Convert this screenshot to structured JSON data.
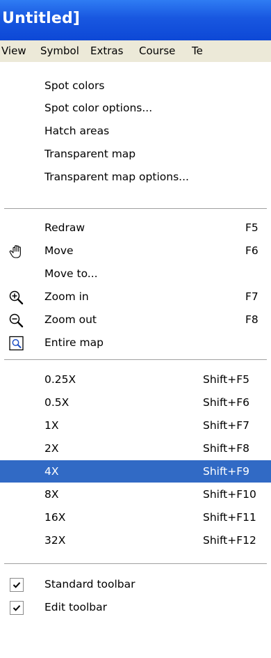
{
  "window": {
    "title": "Untitled]"
  },
  "menubar": {
    "items": [
      "View",
      "Symbol",
      "Extras",
      "Course",
      "Te"
    ]
  },
  "menu": {
    "group1": [
      {
        "label": "Spot colors"
      },
      {
        "label": "Spot color options..."
      },
      {
        "label": "Hatch areas"
      },
      {
        "label": "Transparent map"
      },
      {
        "label": "Transparent map options..."
      }
    ],
    "group2": [
      {
        "label": "Redraw",
        "shortcut": "F5",
        "icon": ""
      },
      {
        "label": "Move",
        "shortcut": "F6",
        "icon": "hand-icon"
      },
      {
        "label": "Move to...",
        "shortcut": "",
        "icon": ""
      },
      {
        "label": "Zoom in",
        "shortcut": "F7",
        "icon": "zoom-in-icon"
      },
      {
        "label": "Zoom out",
        "shortcut": "F8",
        "icon": "zoom-out-icon"
      },
      {
        "label": "Entire map",
        "shortcut": "",
        "icon": "entire-map-icon"
      }
    ],
    "group3": [
      {
        "label": "0.25X",
        "shortcut": "Shift+F5"
      },
      {
        "label": "0.5X",
        "shortcut": "Shift+F6"
      },
      {
        "label": "1X",
        "shortcut": "Shift+F7"
      },
      {
        "label": "2X",
        "shortcut": "Shift+F8"
      },
      {
        "label": "4X",
        "shortcut": "Shift+F9",
        "selected": true
      },
      {
        "label": "8X",
        "shortcut": "Shift+F10"
      },
      {
        "label": "16X",
        "shortcut": "Shift+F11"
      },
      {
        "label": "32X",
        "shortcut": "Shift+F12"
      }
    ],
    "group4": [
      {
        "label": "Standard toolbar",
        "checked": true
      },
      {
        "label": "Edit toolbar",
        "checked": true
      }
    ]
  },
  "colors": {
    "titlebar": "#1857e0",
    "selection": "#316ac5",
    "menubar": "#ece9d8",
    "background": "#ecfdea"
  }
}
